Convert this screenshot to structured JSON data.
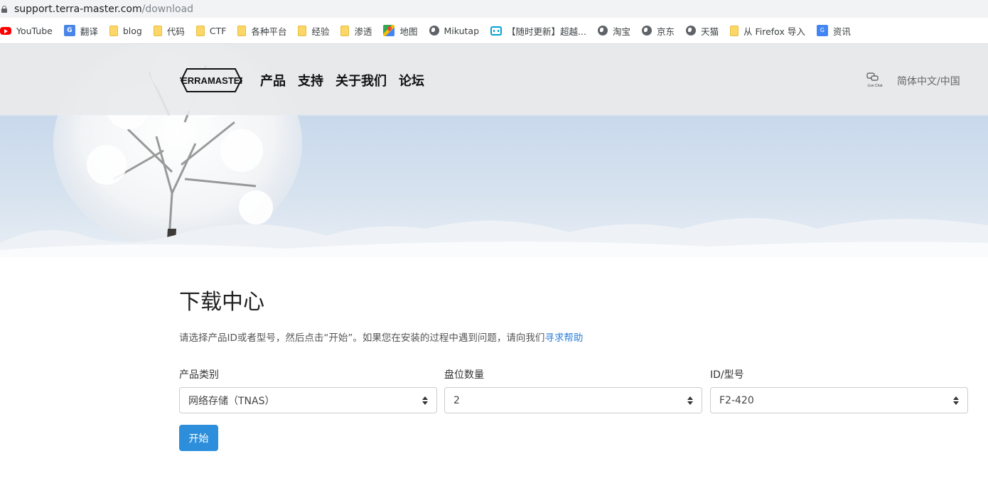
{
  "browser": {
    "url_host": "support.terra-master.com",
    "url_path": "/download",
    "bookmarks": [
      {
        "label": "YouTube",
        "icon": "youtube-icon"
      },
      {
        "label": "翻译",
        "icon": "translate-icon"
      },
      {
        "label": "blog",
        "icon": "folder-icon"
      },
      {
        "label": "代码",
        "icon": "folder-icon"
      },
      {
        "label": "CTF",
        "icon": "folder-icon"
      },
      {
        "label": "各种平台",
        "icon": "folder-icon"
      },
      {
        "label": "经验",
        "icon": "folder-icon"
      },
      {
        "label": "渗透",
        "icon": "folder-icon"
      },
      {
        "label": "地图",
        "icon": "maps-icon"
      },
      {
        "label": "Mikutap",
        "icon": "globe-icon"
      },
      {
        "label": "【随时更新】超越...",
        "icon": "bilibili-icon"
      },
      {
        "label": "淘宝",
        "icon": "globe-icon"
      },
      {
        "label": "京东",
        "icon": "globe-icon"
      },
      {
        "label": "天猫",
        "icon": "globe-icon"
      },
      {
        "label": "从 Firefox 导入",
        "icon": "folder-icon"
      },
      {
        "label": "资讯",
        "icon": "news-icon"
      }
    ]
  },
  "header": {
    "logo_text": "TERRAMASTER",
    "nav": [
      "产品",
      "支持",
      "关于我们",
      "论坛"
    ],
    "livechat_text": "Live Chat",
    "language": "简体中文/中国"
  },
  "main": {
    "title": "下载中心",
    "description": "请选择产品ID或者型号，然后点击“开始”。如果您在安装的过程中遇到问题，请向我们",
    "help_link": "寻求帮助",
    "fields": [
      {
        "label": "产品类别",
        "value": "网络存储（TNAS）"
      },
      {
        "label": "盘位数量",
        "value": "2"
      },
      {
        "label": "ID/型号",
        "value": "F2-420"
      }
    ],
    "start_button": "开始"
  }
}
